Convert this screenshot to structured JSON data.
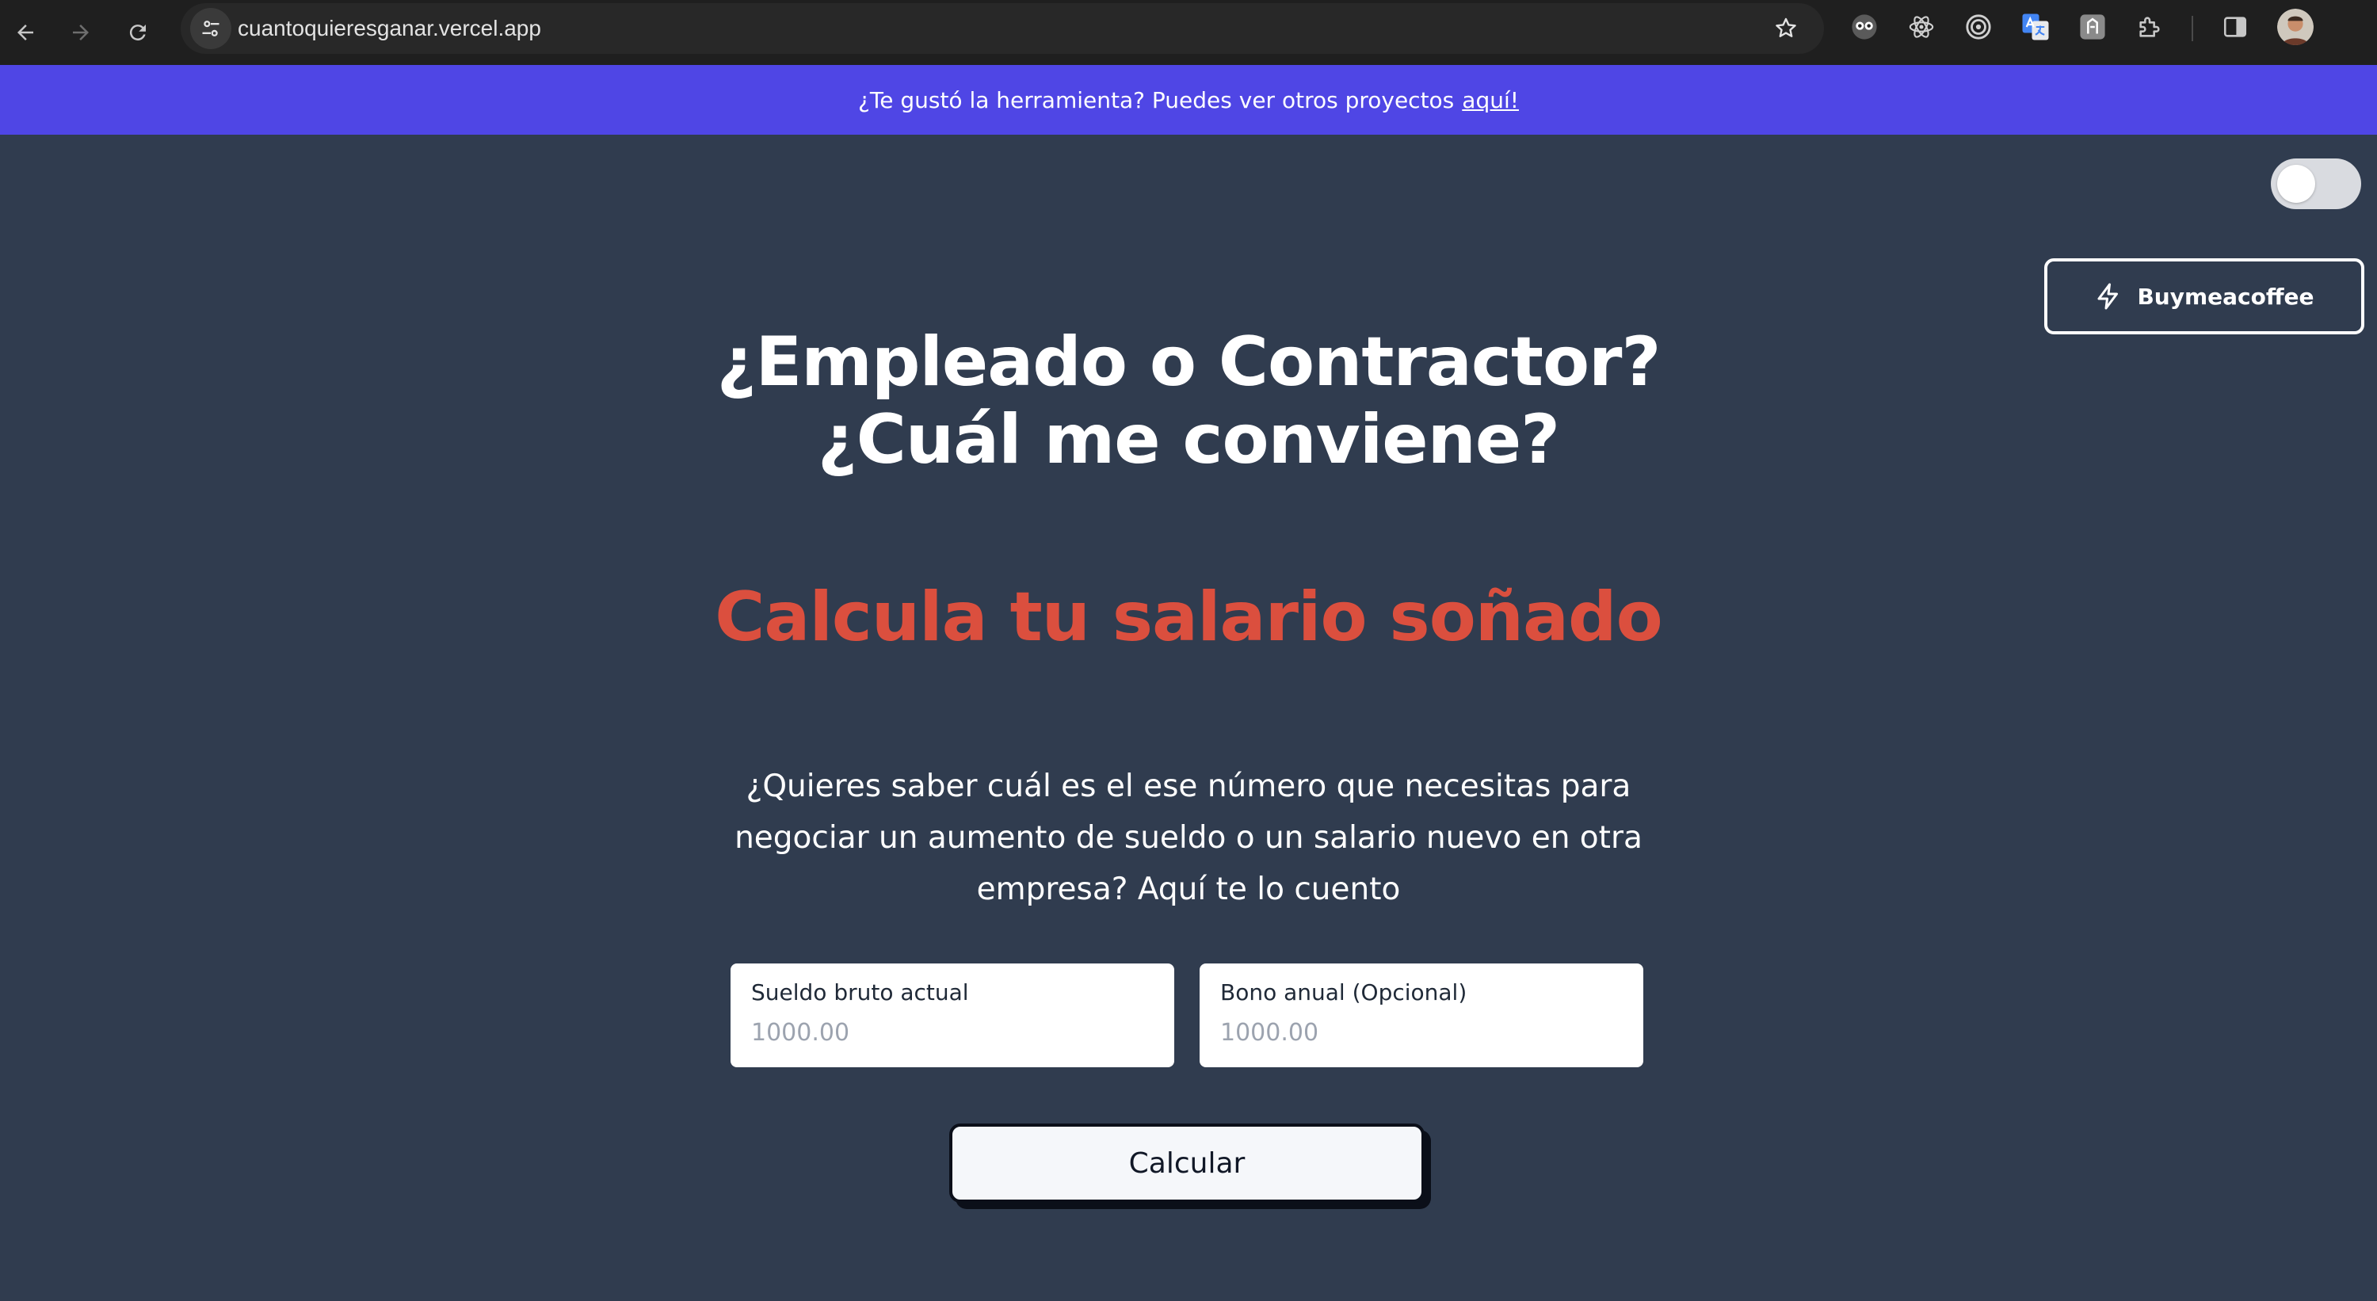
{
  "browser": {
    "url": "cuantoquieresganar.vercel.app",
    "icons": {
      "back": "arrow-left-icon",
      "forward": "arrow-right-icon",
      "reload": "reload-icon",
      "site_info": "tune-icon",
      "bookmark": "star-icon",
      "extensions": [
        "owl-extension-icon",
        "react-devtools-icon",
        "target-extension-icon",
        "google-translate-icon",
        "grey-extension-icon",
        "puzzle-icon"
      ],
      "side_panel": "side-panel-icon",
      "profile": "avatar"
    }
  },
  "banner": {
    "text": "¿Te gustó la herramienta? Puedes ver otros proyectos",
    "link_label": "aquí!",
    "background": "#4f46e5"
  },
  "theme_toggle": {
    "state": "off"
  },
  "coffee_button": {
    "label": "Buymeacoffee",
    "icon": "lightning-icon"
  },
  "hero": {
    "title": "¿Empleado o Contractor? ¿Cuál me conviene?",
    "subtitle": "Calcula tu salario soñado",
    "subtitle_color": "#db4f3e",
    "description": "¿Quieres saber cuál es el ese número que necesitas para negociar un aumento de sueldo o un salario nuevo en otra empresa? Aquí te lo cuento"
  },
  "form": {
    "salary": {
      "label": "Sueldo bruto actual",
      "placeholder": "1000.00",
      "value": ""
    },
    "bonus": {
      "label": "Bono anual (Opcional)",
      "placeholder": "1000.00",
      "value": ""
    },
    "submit_label": "Calcular"
  },
  "colors": {
    "page_background": "#303c4f",
    "chrome_background": "#1f1f1f",
    "accent": "#4f46e5"
  }
}
